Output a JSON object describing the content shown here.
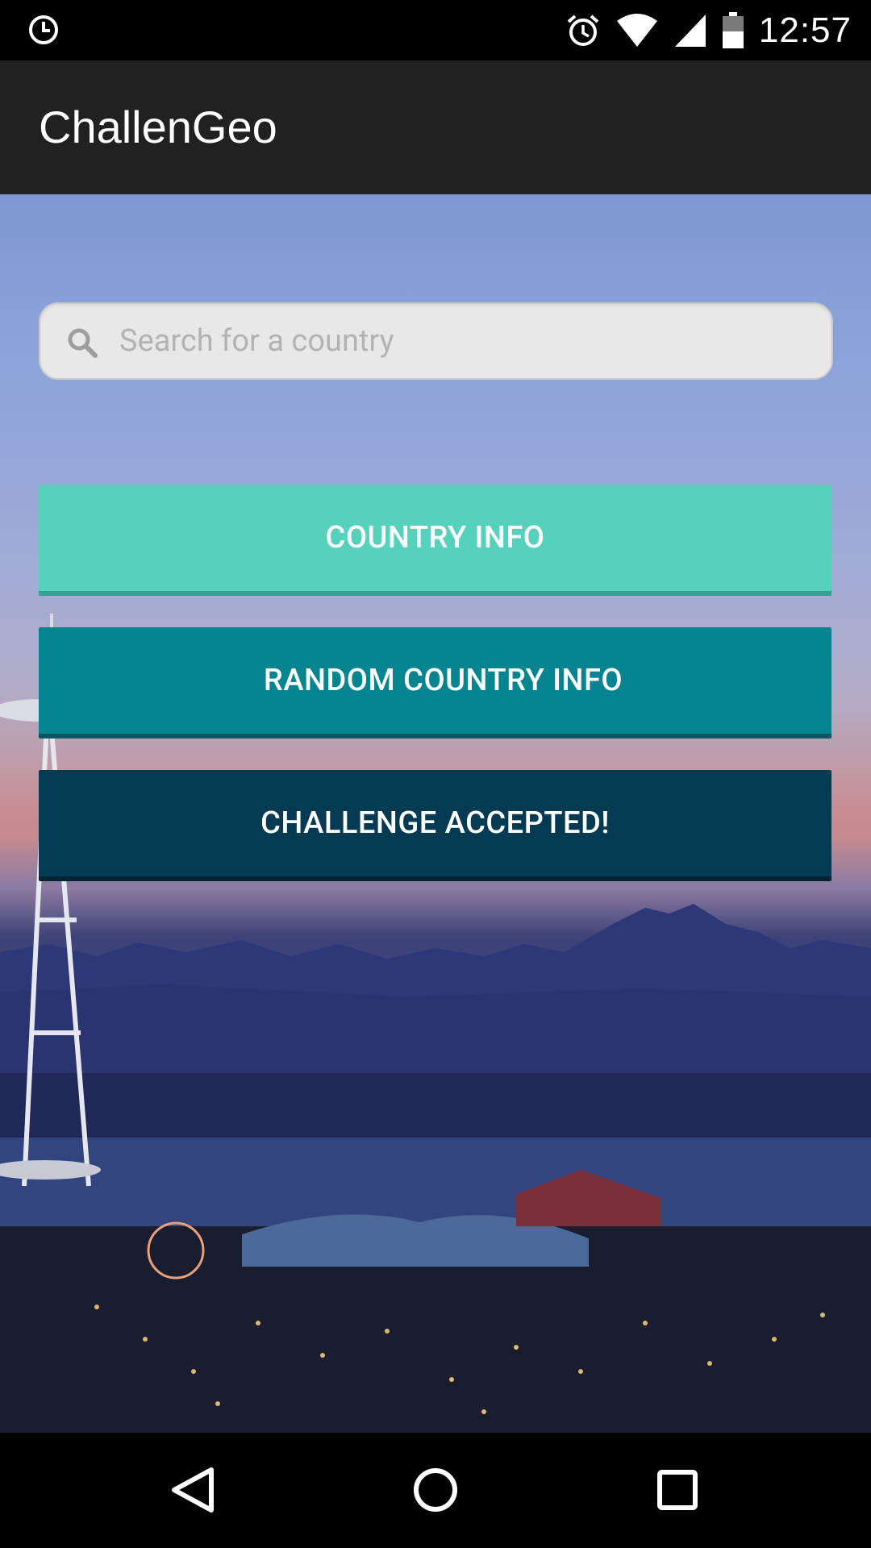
{
  "status_bar": {
    "time": "12:57",
    "left_icon": "sync-clock-icon",
    "icons": [
      "alarm-icon",
      "wifi-icon",
      "signal-icon",
      "battery-icon"
    ]
  },
  "app_bar": {
    "title": "ChallenGeo"
  },
  "search": {
    "placeholder": "Search for a country",
    "value": "",
    "icon": "search-icon"
  },
  "buttons": {
    "country_info": "COUNTRY INFO",
    "random_country_info": "RANDOM COUNTRY INFO",
    "challenge_accepted": "CHALLENGE ACCEPTED!"
  },
  "colors": {
    "app_bar": "#212121",
    "country_info": "#55d1bc",
    "random_country_info": "#068591",
    "challenge_accepted": "#043a52"
  },
  "nav_bar": {
    "icons": [
      "back-icon",
      "home-icon",
      "recents-icon"
    ]
  }
}
